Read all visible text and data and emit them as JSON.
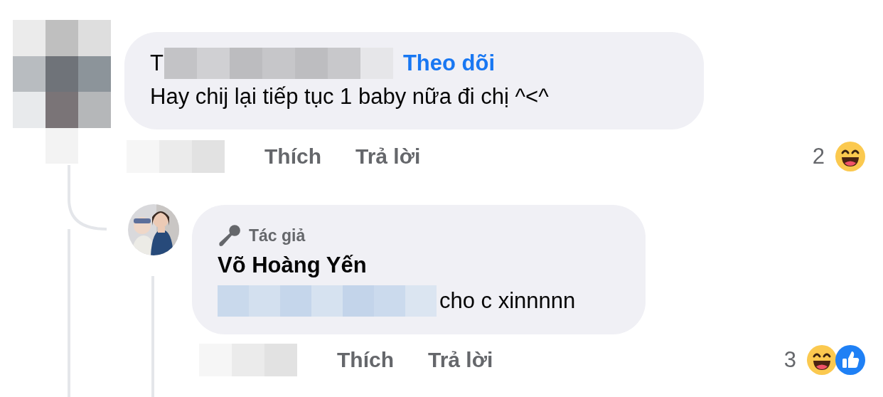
{
  "comments": [
    {
      "avatar": {
        "kind": "pixelated"
      },
      "author": "T",
      "author_redacted": true,
      "follow_link": "Theo dõi",
      "text": "Hay chij lại tiếp tục 1 baby nữa đi chị ^<^",
      "timestamp_redacted": true,
      "actions": [
        "Thích",
        "Trả lời"
      ],
      "reaction_count": "2",
      "reactions": [
        {
          "kind": "haha"
        }
      ]
    },
    {
      "badge_label": "Tác giả",
      "author": "Võ Hoàng Yến",
      "text": "cho c xinnnnn",
      "text_redacted": true,
      "timestamp_redacted": true,
      "actions": [
        "Thích",
        "Trả lời"
      ],
      "reaction_count": "3",
      "reactions": [
        {
          "kind": "haha"
        },
        {
          "kind": "like"
        }
      ]
    }
  ]
}
